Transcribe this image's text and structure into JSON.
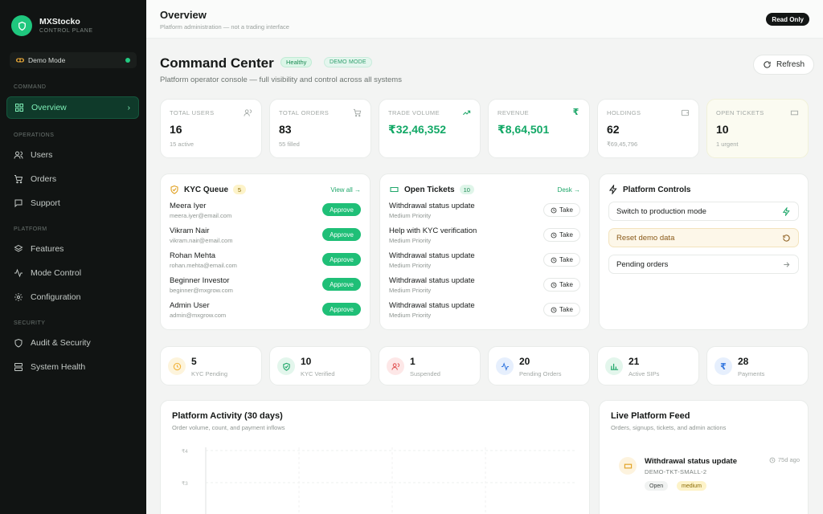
{
  "brand": {
    "name": "MXStocko",
    "subtitle": "CONTROL PLANE"
  },
  "mode_pill": {
    "label": "Demo Mode"
  },
  "sidebar": {
    "sections": [
      "COMMAND",
      "OPERATIONS",
      "PLATFORM",
      "SECURITY"
    ],
    "items": [
      {
        "label": "Overview",
        "icon": "grid-icon",
        "active": true
      },
      {
        "label": "Users",
        "icon": "users-icon"
      },
      {
        "label": "Orders",
        "icon": "cart-icon"
      },
      {
        "label": "Support",
        "icon": "message-icon"
      },
      {
        "label": "Features",
        "icon": "layers-icon"
      },
      {
        "label": "Mode Control",
        "icon": "activity-icon"
      },
      {
        "label": "Configuration",
        "icon": "gear-icon"
      },
      {
        "label": "Audit & Security",
        "icon": "shield-icon"
      },
      {
        "label": "System Health",
        "icon": "server-icon"
      }
    ]
  },
  "topbar": {
    "title": "Overview",
    "subtitle": "Platform administration — not a trading interface",
    "badge": "Read Only"
  },
  "header": {
    "title": "Command Center",
    "healthy": "Healthy",
    "demo": "DEMO MODE",
    "subtitle": "Platform operator console — full visibility and control across all systems",
    "refresh": "Refresh"
  },
  "stats": [
    {
      "label": "TOTAL USERS",
      "value": "16",
      "sub": "15 active",
      "icon": "users-icon"
    },
    {
      "label": "TOTAL ORDERS",
      "value": "83",
      "sub": "55 filled",
      "icon": "cart-icon"
    },
    {
      "label": "TRADE VOLUME",
      "value": "₹32,46,352",
      "sub": "",
      "icon": "trending-up-icon"
    },
    {
      "label": "REVENUE",
      "value": "₹8,64,501",
      "sub": "",
      "icon": "rupee-icon"
    },
    {
      "label": "HOLDINGS",
      "value": "62",
      "sub": "₹69,45,796",
      "icon": "wallet-icon"
    },
    {
      "label": "OPEN TICKETS",
      "value": "10",
      "sub": "1 urgent",
      "icon": "ticket-icon"
    }
  ],
  "kyc": {
    "title": "KYC Queue",
    "count": "5",
    "link": "View all →",
    "action": "Approve",
    "rows": [
      {
        "name": "Meera Iyer",
        "email": "meera.iyer@email.com"
      },
      {
        "name": "Vikram Nair",
        "email": "vikram.nair@email.com"
      },
      {
        "name": "Rohan Mehta",
        "email": "rohan.mehta@email.com"
      },
      {
        "name": "Beginner Investor",
        "email": "beginner@mxgrow.com"
      },
      {
        "name": "Admin User",
        "email": "admin@mxgrow.com"
      }
    ]
  },
  "tickets": {
    "title": "Open Tickets",
    "count": "10",
    "link": "Desk →",
    "action": "Take",
    "rows": [
      {
        "title": "Withdrawal status update",
        "priority": "Medium Priority"
      },
      {
        "title": "Help with KYC verification",
        "priority": "Medium Priority"
      },
      {
        "title": "Withdrawal status update",
        "priority": "Medium Priority"
      },
      {
        "title": "Withdrawal status update",
        "priority": "Medium Priority"
      },
      {
        "title": "Withdrawal status update",
        "priority": "Medium Priority"
      }
    ]
  },
  "controls": {
    "title": "Platform Controls",
    "buttons": [
      {
        "label": "Switch to production mode",
        "icon": "bolt-icon"
      },
      {
        "label": "Reset demo data",
        "icon": "rotate-icon"
      },
      {
        "label": "Pending orders",
        "icon": "arrow-right-icon"
      }
    ]
  },
  "mini_stats": [
    {
      "value": "5",
      "label": "KYC Pending",
      "icon": "clock-icon",
      "color": "#f2b33b",
      "bg": "#fdf4dc"
    },
    {
      "value": "10",
      "label": "KYC Verified",
      "icon": "shield-check-icon",
      "color": "#1fa76a",
      "bg": "#e3f6ec"
    },
    {
      "value": "1",
      "label": "Suspended",
      "icon": "users-icon",
      "color": "#e25a5a",
      "bg": "#fde7e7"
    },
    {
      "value": "20",
      "label": "Pending Orders",
      "icon": "activity-icon",
      "color": "#3a7be0",
      "bg": "#e6effd"
    },
    {
      "value": "21",
      "label": "Active SIPs",
      "icon": "bar-chart-icon",
      "color": "#1fa76a",
      "bg": "#e3f6ec"
    },
    {
      "value": "28",
      "label": "Payments",
      "icon": "rupee-icon",
      "color": "#3a7be0",
      "bg": "#e6effd"
    }
  ],
  "activity": {
    "title": "Platform Activity (30 days)",
    "subtitle": "Order volume, count, and payment inflows",
    "ticks": [
      "₹4",
      "₹3"
    ]
  },
  "feed": {
    "title": "Live Platform Feed",
    "subtitle": "Orders, signups, tickets, and admin actions",
    "items": [
      {
        "title": "Withdrawal status update",
        "code": "DEMO-TKT-SMALL-2",
        "time": "75d ago",
        "tags": [
          "Open",
          "medium"
        ]
      }
    ]
  }
}
